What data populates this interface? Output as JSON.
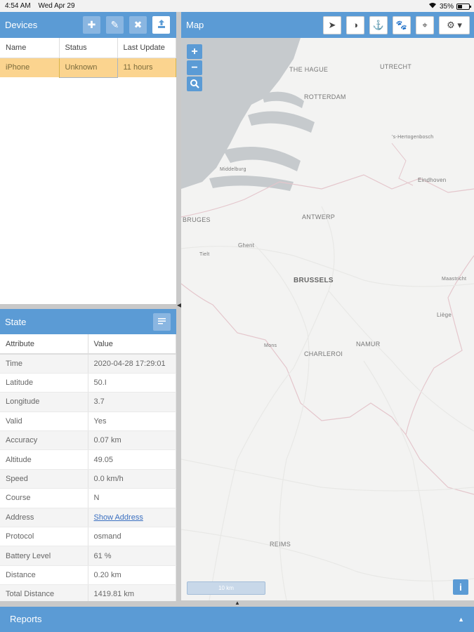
{
  "status_bar": {
    "time": "4:54 AM",
    "date": "Wed Apr 29",
    "battery": "35%"
  },
  "devices": {
    "title": "Devices",
    "columns": [
      "Name",
      "Status",
      "Last Update"
    ],
    "rows": [
      {
        "name": "iPhone",
        "status": "Unknown",
        "last_update": "11 hours"
      }
    ]
  },
  "state": {
    "title": "State",
    "columns": [
      "Attribute",
      "Value"
    ],
    "rows": [
      {
        "attribute": "Time",
        "value": "2020-04-28 17:29:01"
      },
      {
        "attribute": "Latitude",
        "value": "50.I"
      },
      {
        "attribute": "Longitude",
        "value": "3.7"
      },
      {
        "attribute": "Valid",
        "value": "Yes"
      },
      {
        "attribute": "Accuracy",
        "value": "0.07 km"
      },
      {
        "attribute": "Altitude",
        "value": "49.05"
      },
      {
        "attribute": "Speed",
        "value": "0.0 km/h"
      },
      {
        "attribute": "Course",
        "value": "N"
      },
      {
        "attribute": "Address",
        "value": "Show Address"
      },
      {
        "attribute": "Protocol",
        "value": "osmand"
      },
      {
        "attribute": "Battery Level",
        "value": "61 %"
      },
      {
        "attribute": "Distance",
        "value": "0.20 km"
      },
      {
        "attribute": "Total Distance",
        "value": "1419.81 km"
      }
    ]
  },
  "map": {
    "title": "Map",
    "zoom_in": "+",
    "zoom_out": "−",
    "scale_label": "10 km",
    "info": "i",
    "places": [
      "THE HAGUE",
      "UTRECHT",
      "ROTTERDAM",
      "'s-Hertogenbosch",
      "Middelburg",
      "Eindhoven",
      "BRUGES",
      "ANTWERP",
      "Ghent",
      "Tielt",
      "BRUSSELS",
      "Maastricht",
      "Liège",
      "Mons",
      "NAMUR",
      "CHARLEROI",
      "REIMS"
    ]
  },
  "reports": {
    "title": "Reports",
    "caret": "▲"
  },
  "colors": {
    "accent": "#5b9bd5",
    "selected_row": "#fbd48f"
  }
}
